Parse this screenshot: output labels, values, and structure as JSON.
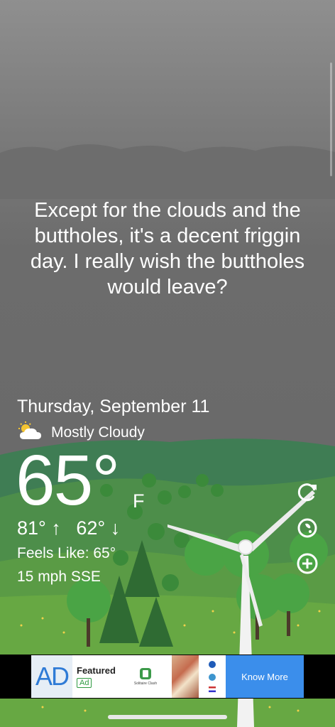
{
  "quote": "Except for the clouds and the buttholes, it's a decent friggin day. I really wish the buttholes would leave?",
  "weather": {
    "date": "Thursday, September 11",
    "condition": "Mostly Cloudy",
    "condition_icon": "partly-cloudy-icon",
    "temperature": "65°",
    "unit": "F",
    "high": "81° ↑",
    "low": "62° ↓",
    "feels_like": "Feels Like: 65°",
    "wind": "15 mph SSE"
  },
  "actions": {
    "refresh_icon": "refresh-icon",
    "location_icon": "globe-icon",
    "add_icon": "plus-circle-icon"
  },
  "ad": {
    "logo": "AD",
    "featured": "Featured",
    "tag": "Ad",
    "app_name": "Solitaire Clash",
    "button": "Know More"
  },
  "colors": {
    "sky": "#7a7a7a",
    "grass": "#5f9a3e",
    "hill": "#4d8444",
    "ad_button": "#3b8eeb"
  }
}
